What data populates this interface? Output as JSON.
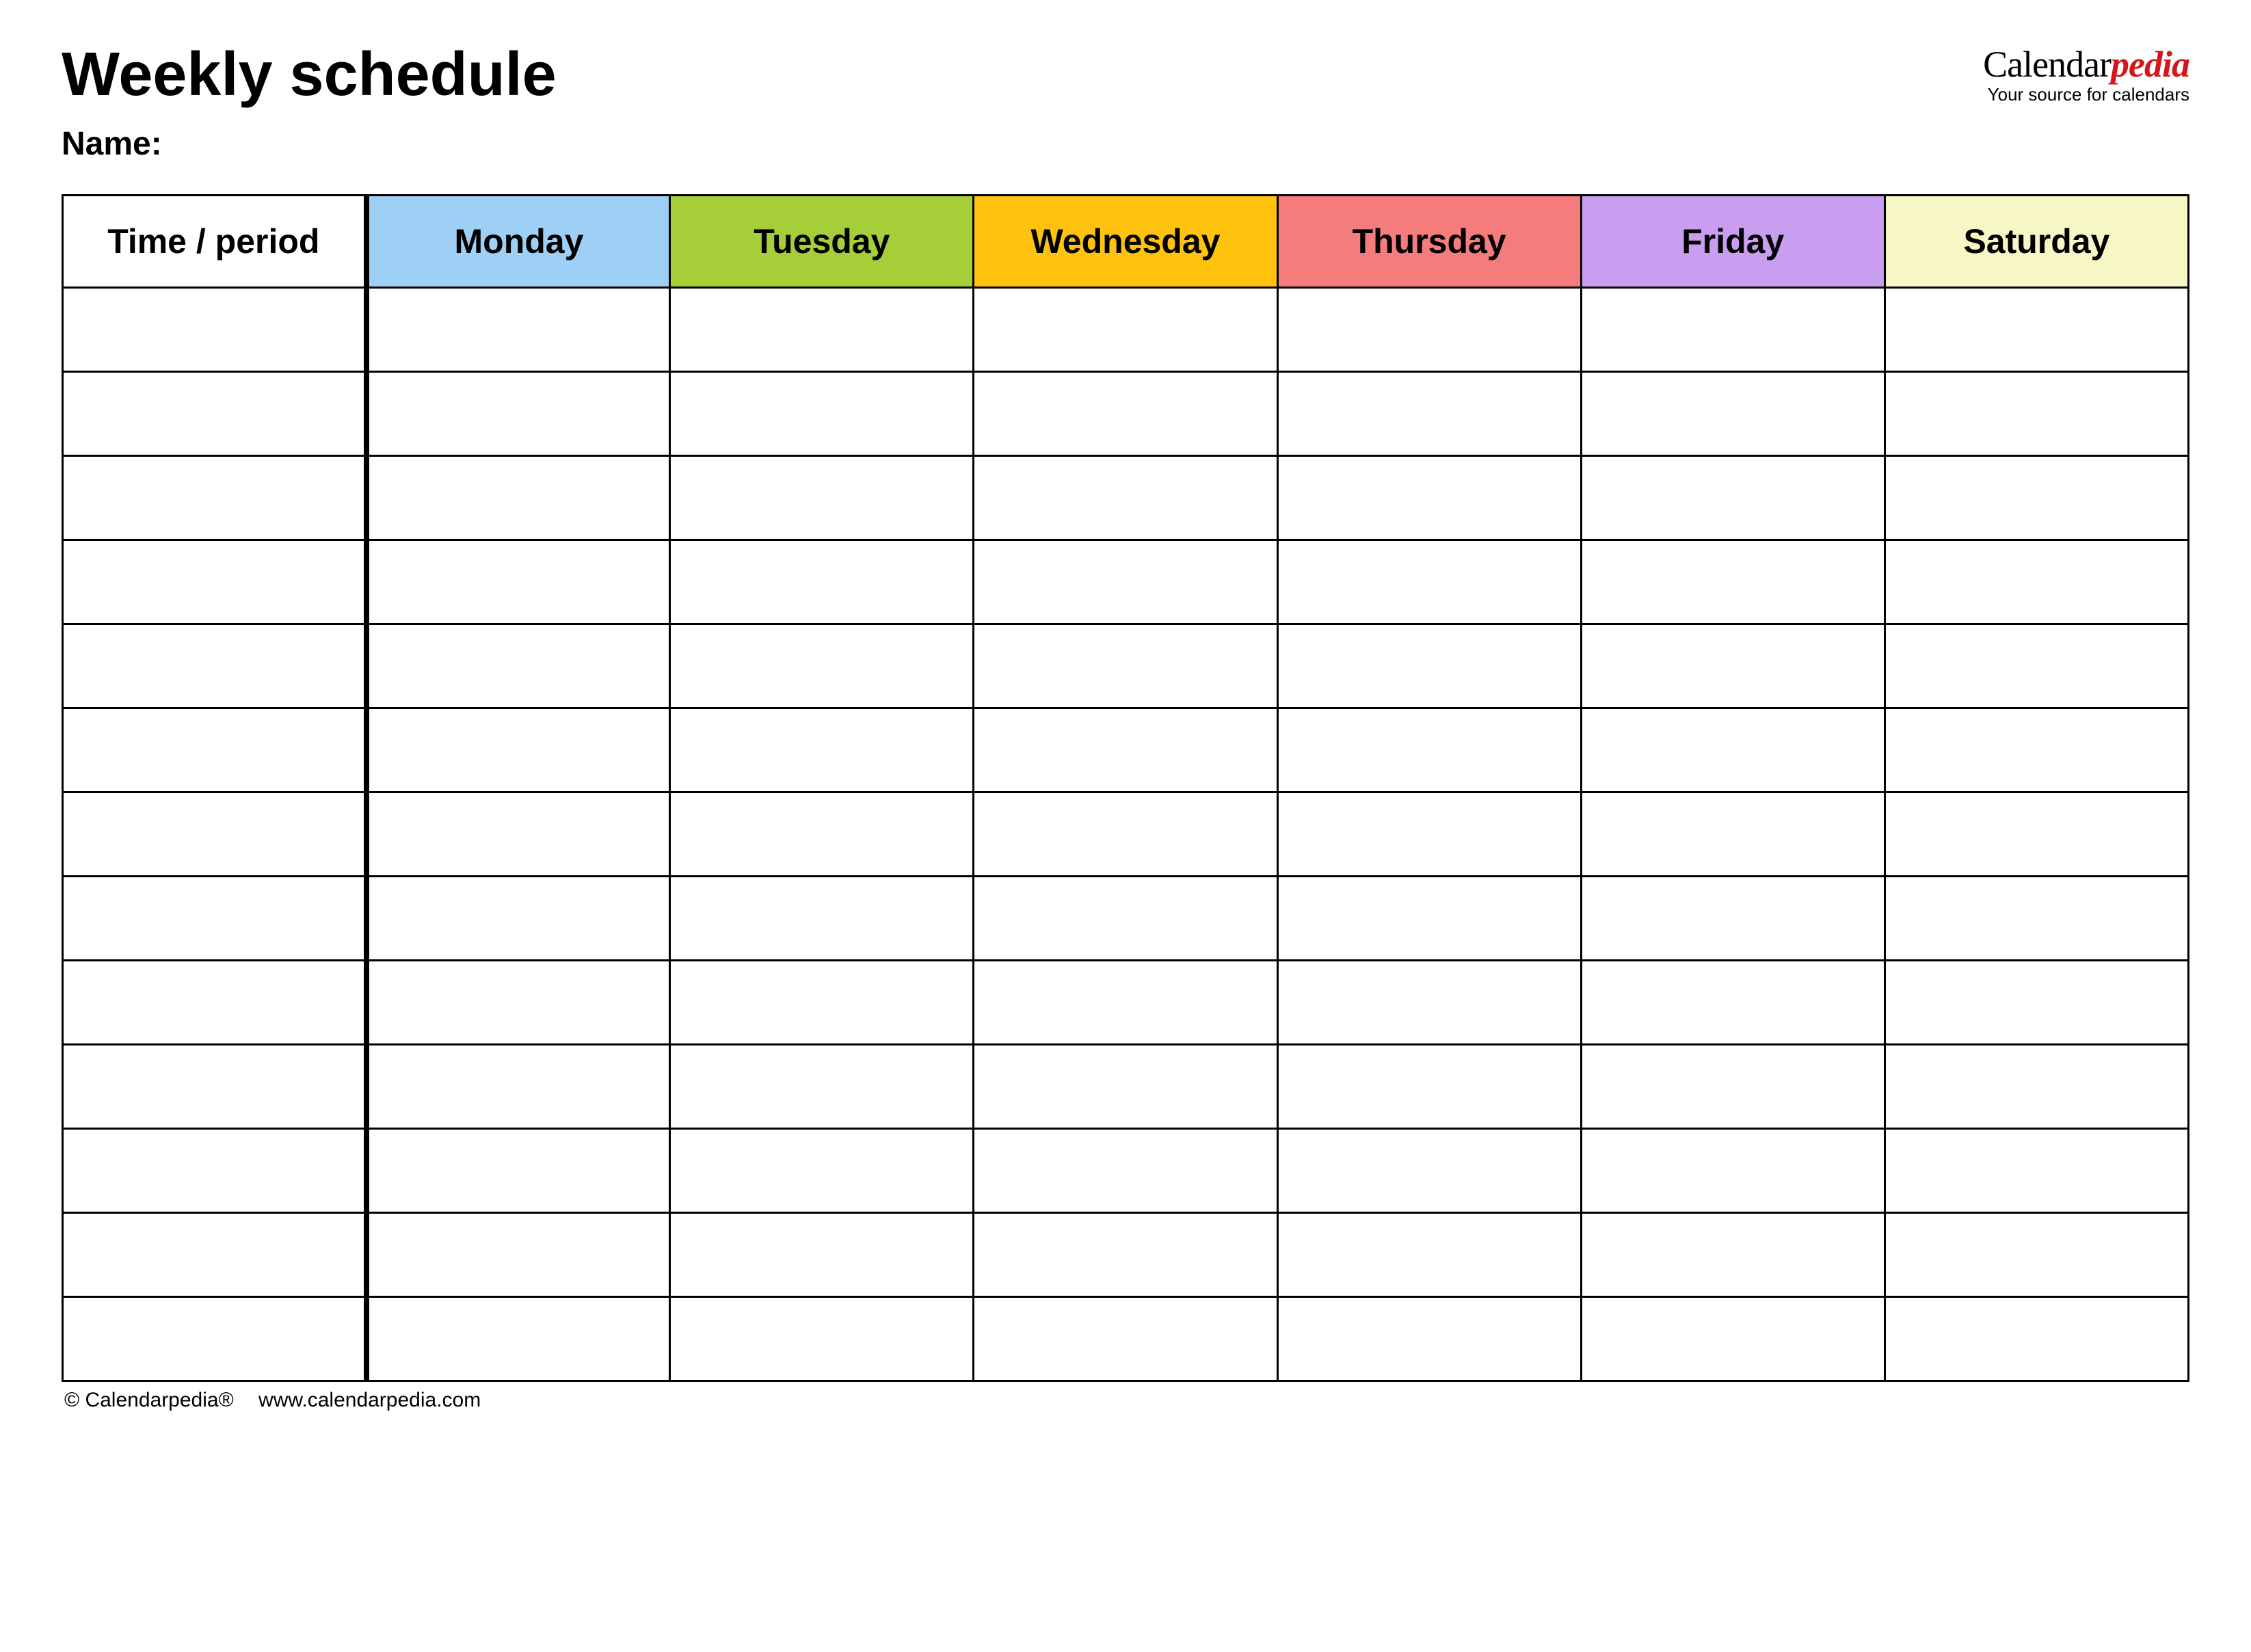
{
  "header": {
    "title": "Weekly schedule",
    "name_label": "Name:"
  },
  "brand": {
    "part1": "Calendar",
    "part2": "pedia",
    "tagline": "Your source for calendars"
  },
  "table": {
    "time_header": "Time / period",
    "days": [
      {
        "label": "Monday",
        "color": "#9ecff5"
      },
      {
        "label": "Tuesday",
        "color": "#a6ce39"
      },
      {
        "label": "Wednesday",
        "color": "#ffc20e"
      },
      {
        "label": "Thursday",
        "color": "#f47c7c"
      },
      {
        "label": "Friday",
        "color": "#c99ef0"
      },
      {
        "label": "Saturday",
        "color": "#f7f6c5"
      }
    ],
    "row_count": 13
  },
  "footer": {
    "copyright": "© Calendarpedia®",
    "url": "www.calendarpedia.com"
  }
}
